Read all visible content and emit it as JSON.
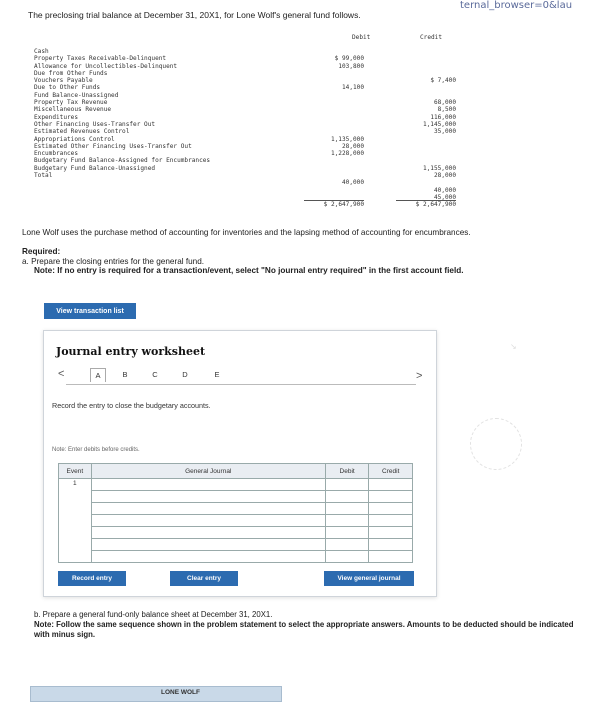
{
  "browser": {
    "url_fragment": "ternal_browser=0&lau"
  },
  "intro": "The preclosing trial balance at December 31, 20X1, for Lone Wolf's general fund follows.",
  "trial_balance": {
    "debit_header": "Debit",
    "credit_header": "Credit",
    "rows": [
      {
        "label": "Cash",
        "debit": "",
        "credit": ""
      },
      {
        "label": "Property Taxes Receivable-Delinquent",
        "debit": "$ 99,000",
        "credit": ""
      },
      {
        "label": "Allowance for Uncollectibles-Delinquent",
        "debit": "103,800",
        "credit": ""
      },
      {
        "label": "Due from Other Funds",
        "debit": "",
        "credit": ""
      },
      {
        "label": "Vouchers Payable",
        "debit": "",
        "credit": "$ 7,400"
      },
      {
        "label": "Due to Other Funds",
        "debit": "14,100",
        "credit": ""
      },
      {
        "label": "Fund Balance-Unassigned",
        "debit": "",
        "credit": ""
      },
      {
        "label": "Property Tax Revenue",
        "debit": "",
        "credit": "68,000"
      },
      {
        "label": "Miscellaneous Revenue",
        "debit": "",
        "credit": "8,500"
      },
      {
        "label": "Expenditures",
        "debit": "",
        "credit": "116,000"
      },
      {
        "label": "Other Financing Uses-Transfer Out",
        "debit": "",
        "credit": "1,145,000"
      },
      {
        "label": "Estimated Revenues Control",
        "debit": "",
        "credit": "35,000"
      },
      {
        "label": "Appropriations Control",
        "debit": "1,135,000",
        "credit": ""
      },
      {
        "label": "Estimated Other Financing Uses-Transfer Out",
        "debit": "28,000",
        "credit": ""
      },
      {
        "label": "Encumbrances",
        "debit": "1,228,000",
        "credit": ""
      },
      {
        "label": "Budgetary Fund Balance-Assigned for Encumbrances",
        "debit": "",
        "credit": ""
      },
      {
        "label": "Budgetary Fund Balance-Unassigned",
        "debit": "",
        "credit": "1,155,000"
      },
      {
        "label": "Total",
        "debit": "",
        "credit": "28,000"
      },
      {
        "label": "",
        "debit": "40,000",
        "credit": ""
      },
      {
        "label": "",
        "debit": "",
        "credit": "40,000"
      },
      {
        "label": "",
        "debit": "",
        "credit": "45,000"
      },
      {
        "label": "",
        "debit": "$ 2,647,900",
        "credit": "$ 2,647,900"
      }
    ]
  },
  "method_note": "Lone Wolf uses the purchase method of accounting for inventories and the lapsing method of accounting for encumbrances.",
  "required": {
    "label": "Required:",
    "part_a": "a. Prepare the closing entries for the general fund.",
    "part_a_note": "Note: If no entry is required for a transaction/event, select \"No journal entry required\" in the first account field."
  },
  "buttons": {
    "view_transaction_list": "View transaction list",
    "record_entry": "Record entry",
    "clear_entry": "Clear entry",
    "view_general_journal": "View general journal"
  },
  "worksheet": {
    "title": "Journal entry worksheet",
    "tabs": [
      "A",
      "B",
      "C",
      "D",
      "E"
    ],
    "prev_arrow": "<",
    "next_arrow": ">",
    "instruction": "Record the entry to close the budgetary accounts.",
    "note": "Note: Enter debits before credits.",
    "columns": {
      "event": "Event",
      "general_journal": "General Journal",
      "debit": "Debit",
      "credit": "Credit"
    },
    "first_event": "1"
  },
  "part_b": {
    "text": "b. Prepare a general fund-only balance sheet at December 31, 20X1.",
    "note": "Note: Follow the same sequence shown in the problem statement to select the appropriate answers. Amounts to be deducted should be indicated with minus sign."
  },
  "bottom_box_label": "LONE WOLF"
}
